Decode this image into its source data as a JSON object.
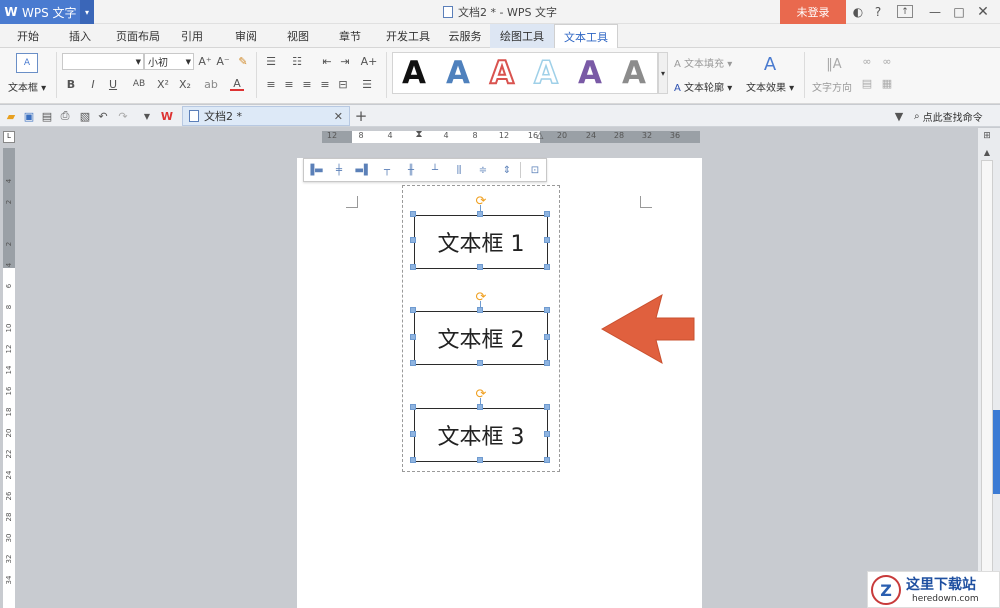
{
  "app": {
    "name": "WPS 文字",
    "title": "文档2 * - WPS 文字",
    "login": "未登录"
  },
  "tabs": [
    "开始",
    "插入",
    "页面布局",
    "引用",
    "审阅",
    "视图",
    "章节",
    "开发工具",
    "云服务",
    "绘图工具",
    "文本工具"
  ],
  "ribbon": {
    "textbox_label": "文本框",
    "font_size": "小初",
    "text_fill": "文本填充",
    "text_outline": "文本轮廓",
    "text_effect": "文本效果",
    "text_direction": "文字方向"
  },
  "art_styles": [
    {
      "glyph": "A",
      "color": "#111111"
    },
    {
      "glyph": "A",
      "color": "#4f81bd"
    },
    {
      "glyph": "A",
      "color": "#d9534f"
    },
    {
      "glyph": "A",
      "color": "#9fd0e8"
    },
    {
      "glyph": "A",
      "color": "#7a5aa6"
    },
    {
      "glyph": "A",
      "color": "#8c8c8c"
    }
  ],
  "doc_tab": {
    "name": "文档2 *"
  },
  "search": {
    "label": "点此查找命令"
  },
  "hruler": [
    "12",
    "8",
    "4",
    "4",
    "8",
    "12",
    "16",
    "20",
    "24",
    "28",
    "32",
    "36"
  ],
  "vruler": [
    "4",
    "2",
    "2",
    "4",
    "6",
    "8",
    "10",
    "12",
    "14",
    "16",
    "18",
    "20",
    "22",
    "24",
    "26",
    "28",
    "30",
    "32",
    "34"
  ],
  "textboxes": [
    "文本框 1",
    "文本框 2",
    "文本框 3"
  ],
  "colors": {
    "accent": "#4a7bd0",
    "login": "#e9694e",
    "arrow": "#e0603e"
  },
  "watermark": {
    "title": "这里下载站",
    "url": "heredown.com"
  }
}
